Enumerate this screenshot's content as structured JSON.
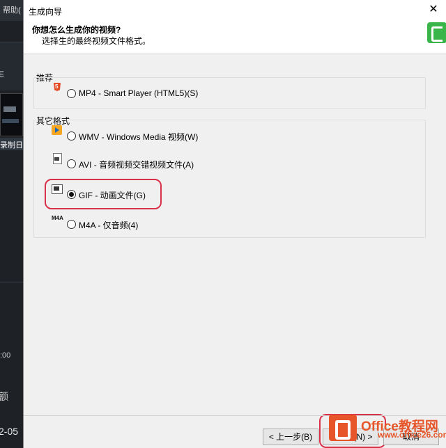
{
  "background_app": {
    "menu_label": "帮助(",
    "side_text": "E",
    "recording_label": "录制日",
    "time_text": ":00",
    "bottom_text": "额",
    "date_text": "2-05"
  },
  "dialog": {
    "title": "生成向导",
    "close_icon": "close-icon",
    "header_title": "你想怎么生成你的视频?",
    "header_subtitle": "选择生的最终视频文件格式。",
    "logo_icon": "camtasia-logo",
    "recommended_label": "推荐",
    "recommended_options": [
      {
        "label": "MP4 - Smart Player (HTML5)(S)",
        "icon": "html5-icon",
        "selected": false
      }
    ],
    "other_label": "其它格式",
    "other_options": [
      {
        "label": "WMV - Windows Media 视频(W)",
        "icon": "wmv-icon",
        "selected": false
      },
      {
        "label": "AVI - 音频视频交错视频文件(A)",
        "icon": "avi-icon",
        "selected": false
      },
      {
        "label": "GIF - 动画文件(G)",
        "icon": "gif-icon",
        "selected": true
      },
      {
        "label": "M4A - 仅音频(4)",
        "icon": "M4A",
        "selected": false
      }
    ],
    "buttons": {
      "back": "< 上一步(B)",
      "next": "下一步(N) >",
      "cancel": "取消"
    }
  },
  "watermark": {
    "title": "Office教程网",
    "url": "www.office26.com"
  },
  "colors": {
    "highlight": "#d9314a",
    "watermark": "#e6562a"
  }
}
